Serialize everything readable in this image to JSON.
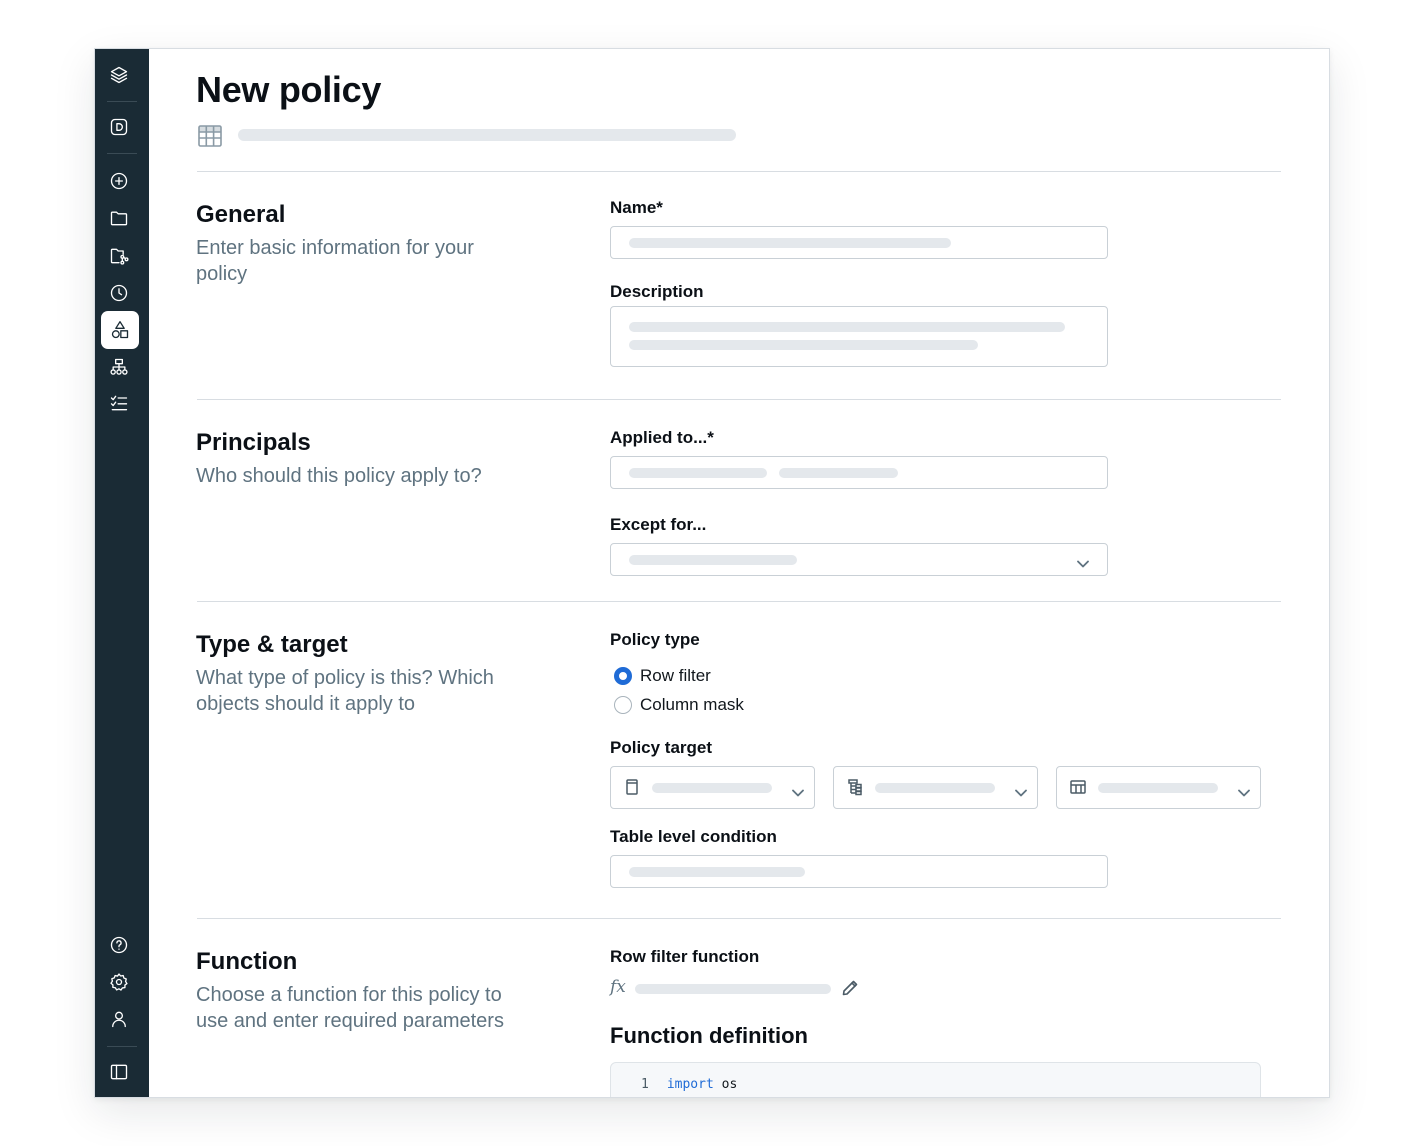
{
  "page": {
    "title": "New policy"
  },
  "sections": {
    "general": {
      "title": "General",
      "description": "Enter basic information for your policy",
      "name_label": "Name*",
      "description_label": "Description"
    },
    "principals": {
      "title": "Principals",
      "description": "Who should this policy apply to?",
      "applied_to_label": "Applied to...*",
      "except_for_label": "Except for..."
    },
    "type_target": {
      "title": "Type & target",
      "description": "What type of policy is this? Which objects should it apply to",
      "policy_type_label": "Policy type",
      "policy_type_options": [
        "Row filter",
        "Column mask"
      ],
      "policy_type_selected": "Row filter",
      "policy_target_label": "Policy target",
      "table_condition_label": "Table level condition"
    },
    "function": {
      "title": "Function",
      "description": "Choose a function for this policy to use and enter required parameters",
      "row_filter_label": "Row filter function",
      "fx_symbol": "fx",
      "definition_title": "Function definition",
      "code": {
        "line_number": "1",
        "keyword": "import",
        "identifier": "os"
      }
    }
  },
  "sidebar": {
    "icons": [
      "layers-icon",
      "workspace-d-icon",
      "new-plus-icon",
      "folder-icon",
      "repos-icon",
      "recents-clock-icon",
      "catalog-shapes-icon",
      "hierarchy-icon",
      "tasks-list-icon",
      "help-icon",
      "settings-icon",
      "user-icon",
      "panel-toggle-icon"
    ],
    "active": "catalog-shapes-icon"
  },
  "colors": {
    "sidebar_bg": "#1a2b35",
    "accent": "#1f6bd6",
    "skeleton": "#e4e8ec"
  }
}
